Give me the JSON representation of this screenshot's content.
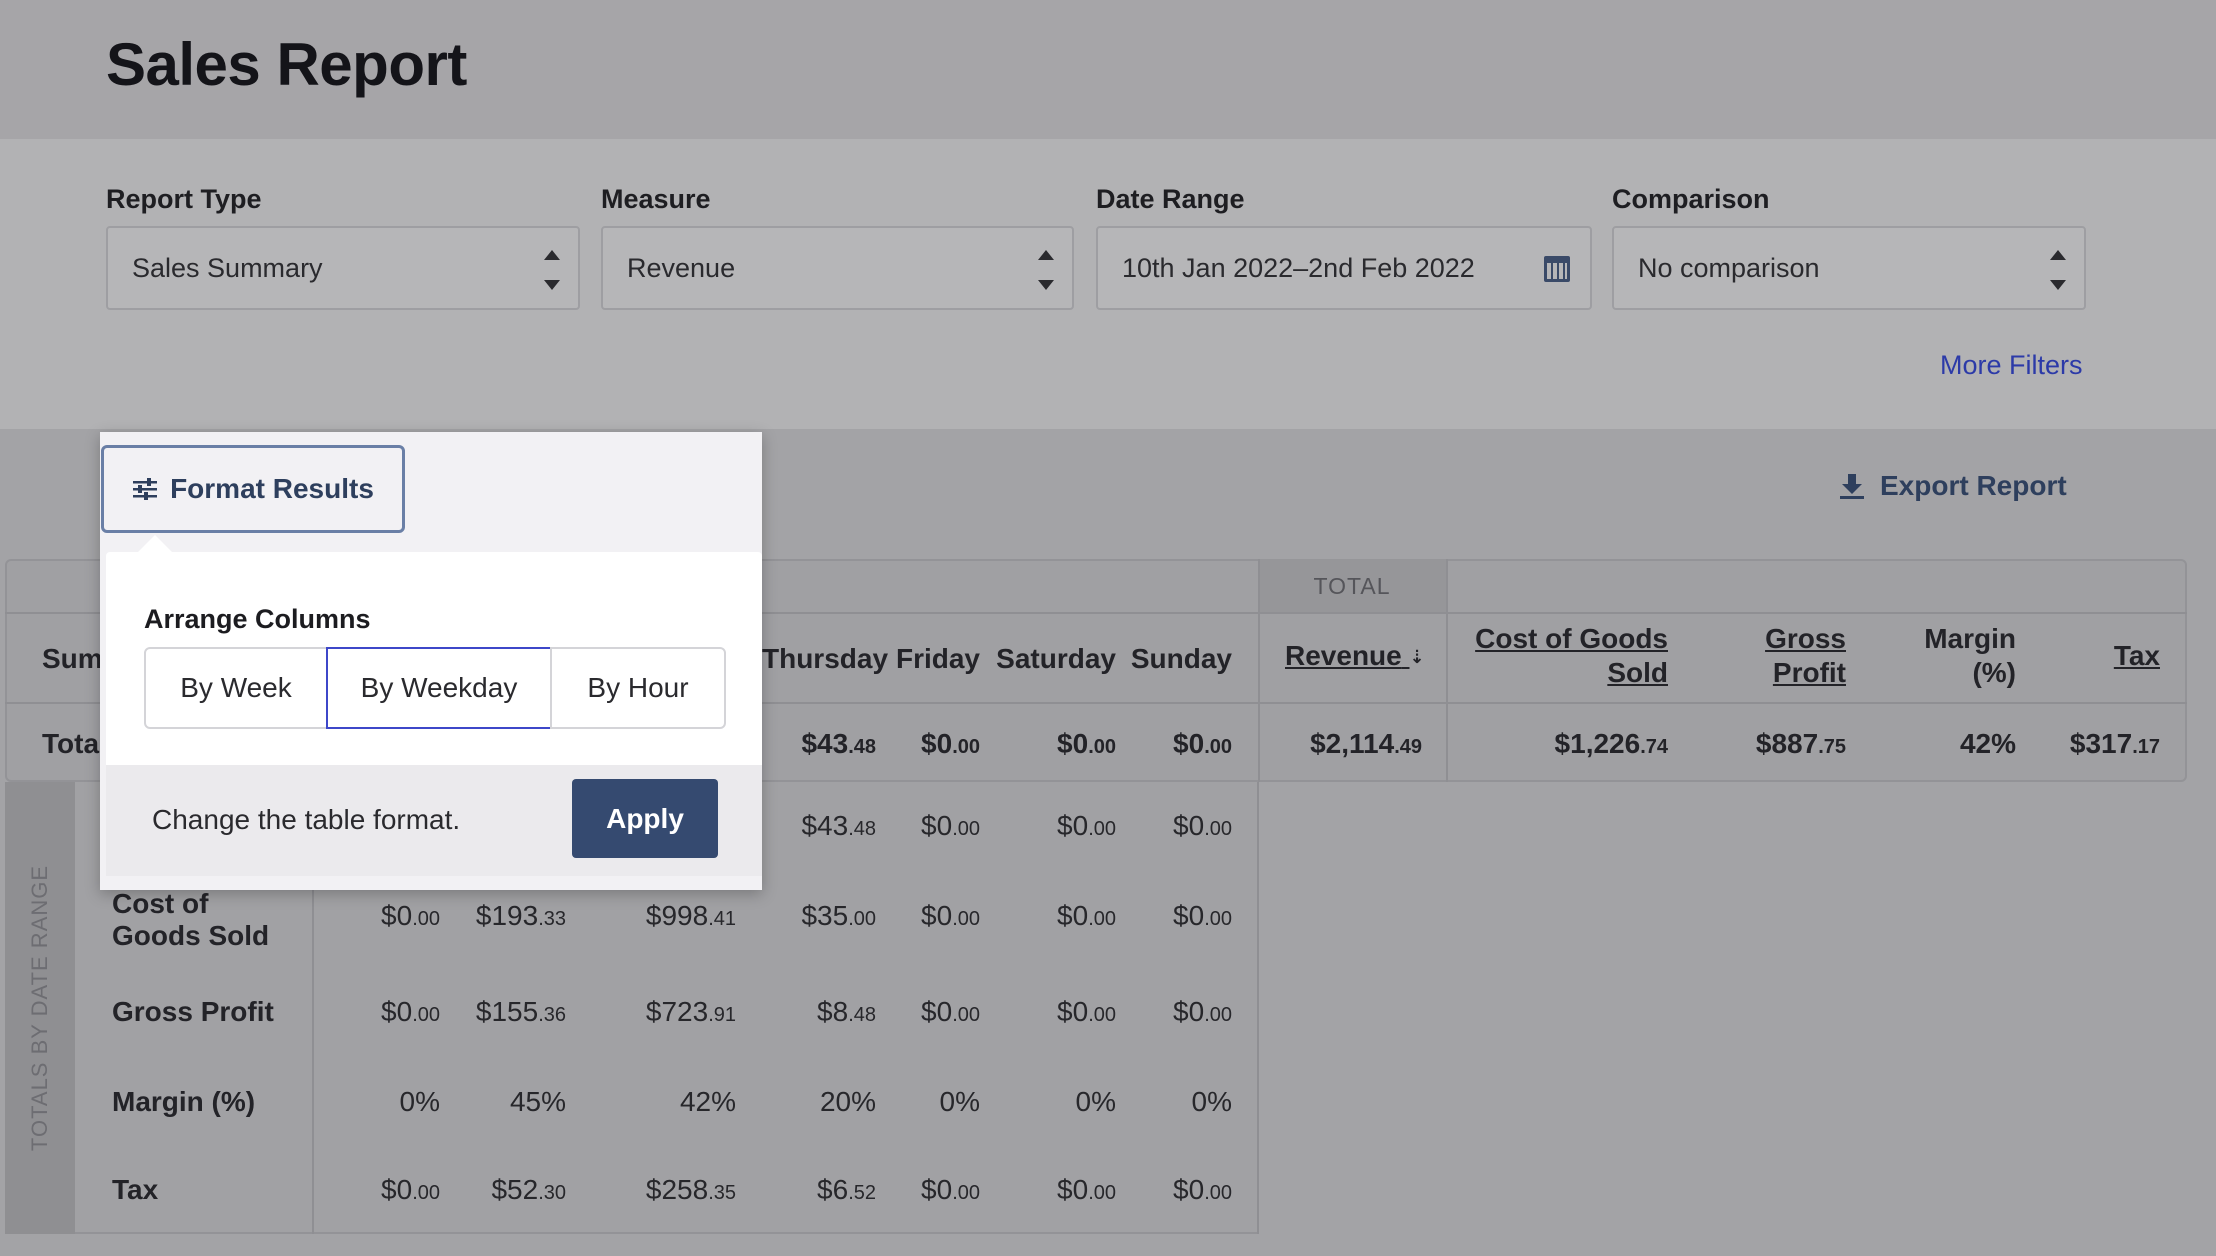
{
  "page": {
    "title": "Sales Report"
  },
  "filters": {
    "report_type": {
      "label": "Report Type",
      "value": "Sales Summary"
    },
    "measure": {
      "label": "Measure",
      "value": "Revenue"
    },
    "date_range": {
      "label": "Date Range",
      "value": "10th Jan 2022–2nd Feb 2022"
    },
    "comparison": {
      "label": "Comparison",
      "value": "No comparison"
    },
    "more_filters": "More Filters"
  },
  "toolbar": {
    "format_results": "Format Results",
    "export_report": "Export Report"
  },
  "popover": {
    "arrange_label": "Arrange Columns",
    "options": [
      "By Week",
      "By Weekday",
      "By Hour"
    ],
    "selected": "By Weekday",
    "footer_text": "Change the table format.",
    "apply_label": "Apply"
  },
  "table": {
    "group_total_label": "TOTAL",
    "summary_header": "Summ",
    "totals_label": "Totals",
    "day_headers": [
      "Thursday",
      "Friday",
      "Saturday",
      "Sunday"
    ],
    "total_headers": [
      "Revenue",
      "Cost of Goods Sold",
      "Gross Profit",
      "Margin (%)",
      "Tax"
    ],
    "sort_glyph": "⇣",
    "totals_row": {
      "thursday": [
        "$43",
        ".48"
      ],
      "friday": [
        "$0",
        ".00"
      ],
      "saturday": [
        "$0",
        ".00"
      ],
      "sunday": [
        "$0",
        ".00"
      ],
      "revenue": [
        "$2,114",
        ".49"
      ],
      "cogs": [
        "$1,226",
        ".74"
      ],
      "gross": [
        "$887",
        ".75"
      ],
      "margin": "42%",
      "tax": [
        "$317",
        ".17"
      ]
    },
    "side_label": "TOTALS BY DATE RANGE",
    "rows": [
      {
        "label": "",
        "values": [
          [
            "",
            ""
          ],
          [
            "",
            ""
          ],
          [
            "",
            ""
          ],
          [
            "$43",
            ".48"
          ],
          [
            "$0",
            ".00"
          ],
          [
            "$0",
            ".00"
          ],
          [
            "$0",
            ".00"
          ]
        ]
      },
      {
        "label": "Cost of Goods Sold",
        "values": [
          [
            "$0",
            ".00"
          ],
          [
            "$193",
            ".33"
          ],
          [
            "$998",
            ".41"
          ],
          [
            "$35",
            ".00"
          ],
          [
            "$0",
            ".00"
          ],
          [
            "$0",
            ".00"
          ],
          [
            "$0",
            ".00"
          ]
        ]
      },
      {
        "label": "Gross Profit",
        "values": [
          [
            "$0",
            ".00"
          ],
          [
            "$155",
            ".36"
          ],
          [
            "$723",
            ".91"
          ],
          [
            "$8",
            ".48"
          ],
          [
            "$0",
            ".00"
          ],
          [
            "$0",
            ".00"
          ],
          [
            "$0",
            ".00"
          ]
        ]
      },
      {
        "label": "Margin (%)",
        "values": [
          [
            "0%",
            ""
          ],
          [
            "45%",
            ""
          ],
          [
            "42%",
            ""
          ],
          [
            "20%",
            ""
          ],
          [
            "0%",
            ""
          ],
          [
            "0%",
            ""
          ],
          [
            "0%",
            ""
          ]
        ]
      },
      {
        "label": "Tax",
        "values": [
          [
            "$0",
            ".00"
          ],
          [
            "$52",
            ".30"
          ],
          [
            "$258",
            ".35"
          ],
          [
            "$6",
            ".52"
          ],
          [
            "$0",
            ".00"
          ],
          [
            "$0",
            ".00"
          ],
          [
            "$0",
            ".00"
          ]
        ]
      }
    ]
  }
}
